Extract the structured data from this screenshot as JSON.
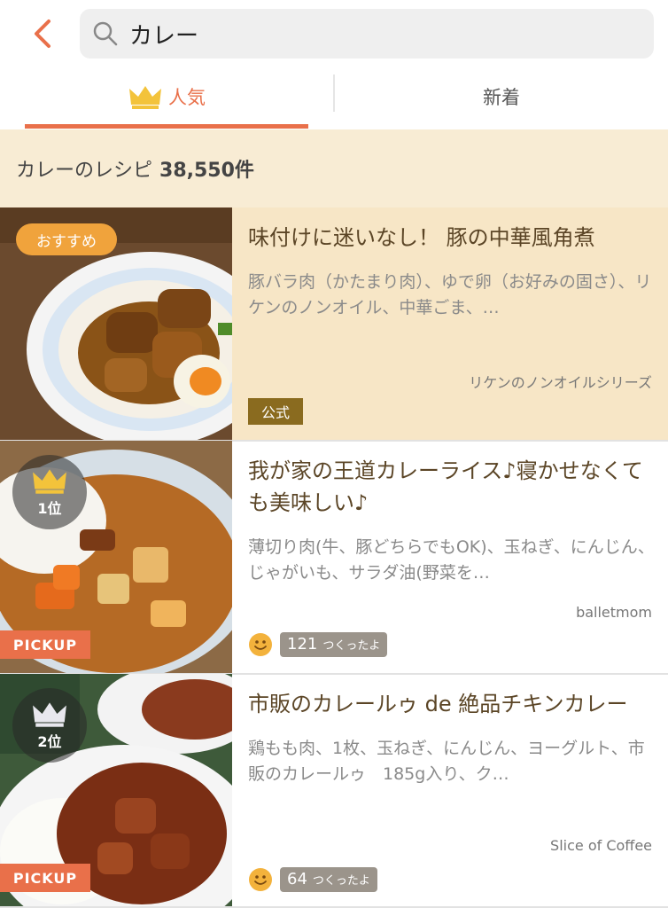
{
  "search": {
    "query": "カレー"
  },
  "tabs": {
    "popular": "人気",
    "new": "新着"
  },
  "result": {
    "label": "カレーのレシピ",
    "count": "38,550件"
  },
  "recipes": [
    {
      "badge": "おすすめ",
      "title": "味付けに迷いなし！ 豚の中華風角煮",
      "ingredients": "豚バラ肉（かたまり肉）、ゆで卵（お好みの固さ）、リケンのノンオイル、中華ごま、…",
      "author": "リケンのノンオイルシリーズ",
      "official": "公式"
    },
    {
      "rank": "1位",
      "pickup": "PICKUP",
      "title": "我が家の王道カレーライス♪寝かせなくても美味しい♪",
      "ingredients": "薄切り肉(牛、豚どちらでもOK)、玉ねぎ、にんじん、じゃがいも、サラダ油(野菜を…",
      "author": "balletmom",
      "made_count": "121",
      "made_label": "つくったよ"
    },
    {
      "rank": "2位",
      "pickup": "PICKUP",
      "title": "市販のカレールゥ de 絶品チキンカレー",
      "ingredients": "鶏もも肉、1枚、玉ねぎ、にんじん、ヨーグルト、市販のカレールゥ　185g入り、ク…",
      "author": "Slice of Coffee",
      "made_count": "64",
      "made_label": "つくったよ"
    }
  ],
  "colors": {
    "accent": "#e9704a",
    "crown_gold": "#f3c33b",
    "highlight_bg": "#f7e6c6"
  },
  "icons": [
    "chevron-left-icon",
    "search-icon",
    "crown-icon",
    "smiley-icon"
  ]
}
